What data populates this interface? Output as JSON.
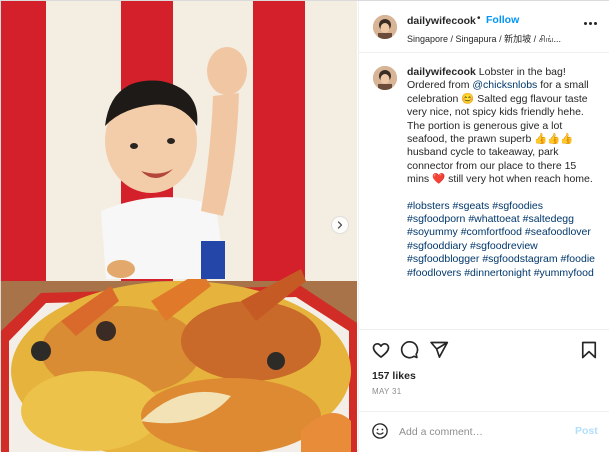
{
  "post": {
    "username": "dailywifecook",
    "follow_label": "Follow",
    "dot": "•",
    "location": "Singapore / Singapura / 新加坡 / சிங்...",
    "caption_lines": [
      "Lobster in the bag!",
      "Ordered from @chicksnlobs for a small celebration 😊 Salted egg flavour taste very nice, not spicy kids friendly hehe.",
      "The portion is generous give a lot seafood, the prawn superb 👍👍👍 husband cycle to takeaway, park connector from our place to there 15 mins ❤️ still very hot when reach home."
    ],
    "caption_mention": "@chicksnlobs",
    "hashtags": [
      "#lobsters",
      "#sgeats",
      "#sgfoodies",
      "#sgfoodporn",
      "#whattoeat",
      "#saltedegg",
      "#soyummy",
      "#comfortfood",
      "#seafoodlover",
      "#sgfooddiary",
      "#sgfoodreview",
      "#sgfoodblogger",
      "#sgfoodstagram",
      "#foodie",
      "#foodlovers",
      "#dinnertonight",
      "#yummyfood"
    ],
    "likes": "157 likes",
    "date": "MAY 31"
  },
  "comment": {
    "placeholder": "Add a comment…",
    "post_label": "Post"
  },
  "icons": {
    "like": "heart-icon",
    "comment": "comment-icon",
    "share": "paper-plane-icon",
    "save": "bookmark-icon",
    "emoji": "smiley-icon",
    "more": "more-options-icon",
    "next": "chevron-right-icon"
  },
  "colors": {
    "follow": "#0095f6",
    "hashtag": "#00376b",
    "post_disabled": "#b2dffc",
    "muted": "#8e8e8e"
  }
}
